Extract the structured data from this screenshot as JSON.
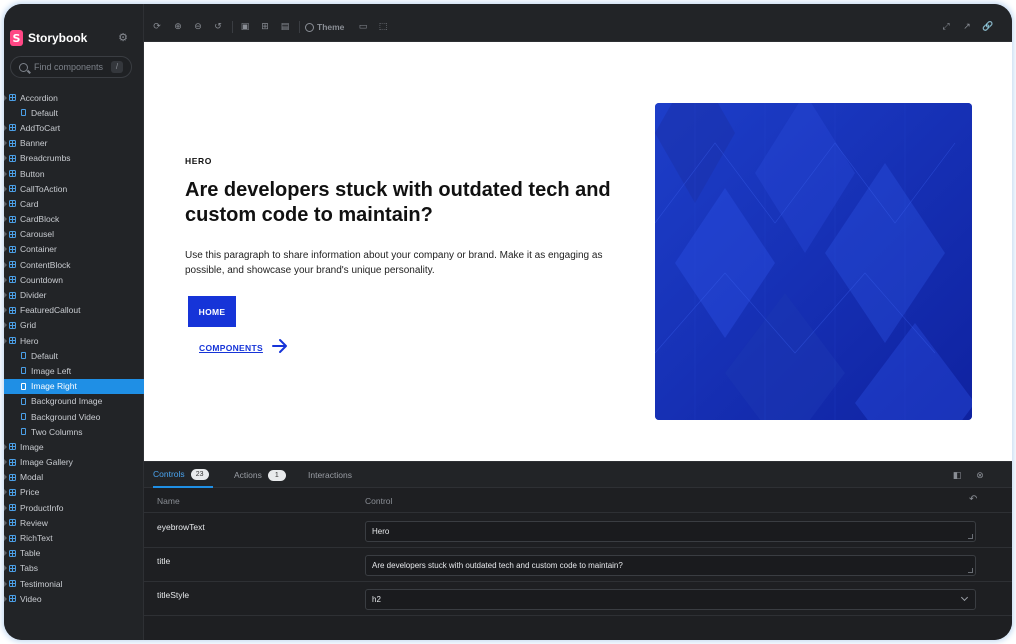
{
  "sidebar": {
    "brand": "Storybook",
    "search_placeholder": "Find components",
    "search_shortcut": "/",
    "items": [
      {
        "label": "Accordion",
        "kind": "component"
      },
      {
        "label": "Default",
        "kind": "story"
      },
      {
        "label": "AddToCart",
        "kind": "component"
      },
      {
        "label": "Banner",
        "kind": "component"
      },
      {
        "label": "Breadcrumbs",
        "kind": "component"
      },
      {
        "label": "Button",
        "kind": "component"
      },
      {
        "label": "CallToAction",
        "kind": "component"
      },
      {
        "label": "Card",
        "kind": "component"
      },
      {
        "label": "CardBlock",
        "kind": "component"
      },
      {
        "label": "Carousel",
        "kind": "component"
      },
      {
        "label": "Container",
        "kind": "component"
      },
      {
        "label": "ContentBlock",
        "kind": "component"
      },
      {
        "label": "Countdown",
        "kind": "component"
      },
      {
        "label": "Divider",
        "kind": "component"
      },
      {
        "label": "FeaturedCallout",
        "kind": "component"
      },
      {
        "label": "Grid",
        "kind": "component"
      },
      {
        "label": "Hero",
        "kind": "component"
      },
      {
        "label": "Default",
        "kind": "story"
      },
      {
        "label": "Image Left",
        "kind": "story"
      },
      {
        "label": "Image Right",
        "kind": "story",
        "selected": true
      },
      {
        "label": "Background Image",
        "kind": "story"
      },
      {
        "label": "Background Video",
        "kind": "story"
      },
      {
        "label": "Two Columns",
        "kind": "story"
      },
      {
        "label": "Image",
        "kind": "component"
      },
      {
        "label": "Image Gallery",
        "kind": "component"
      },
      {
        "label": "Modal",
        "kind": "component"
      },
      {
        "label": "Price",
        "kind": "component"
      },
      {
        "label": "ProductInfo",
        "kind": "component"
      },
      {
        "label": "Review",
        "kind": "component"
      },
      {
        "label": "RichText",
        "kind": "component"
      },
      {
        "label": "Table",
        "kind": "component"
      },
      {
        "label": "Tabs",
        "kind": "component"
      },
      {
        "label": "Testimonial",
        "kind": "component"
      },
      {
        "label": "Video",
        "kind": "component"
      }
    ]
  },
  "toolbar": {
    "theme_label": "Theme"
  },
  "preview": {
    "eyebrow": "HERO",
    "title": "Are developers stuck with outdated tech and custom code to maintain?",
    "paragraph": "Use this paragraph to share information about your company or brand. Make it as engaging as possible, and showcase your brand's unique personality.",
    "primary_button": "HOME",
    "secondary_link": "COMPONENTS"
  },
  "panel": {
    "tabs": [
      {
        "label": "Controls",
        "badge": "23",
        "active": true
      },
      {
        "label": "Actions",
        "badge": "1"
      },
      {
        "label": "Interactions"
      }
    ],
    "columns": {
      "name": "Name",
      "control": "Control"
    },
    "rows": [
      {
        "name": "eyebrowText",
        "value": "Hero",
        "type": "text"
      },
      {
        "name": "title",
        "value": "Are developers stuck with outdated tech and custom code to maintain?",
        "type": "text"
      },
      {
        "name": "titleStyle",
        "value": "h2",
        "type": "select"
      }
    ]
  },
  "colors": {
    "accent": "#1f8fe5",
    "brand_pink": "#ff4785",
    "hero_blue": "#1634d8"
  }
}
